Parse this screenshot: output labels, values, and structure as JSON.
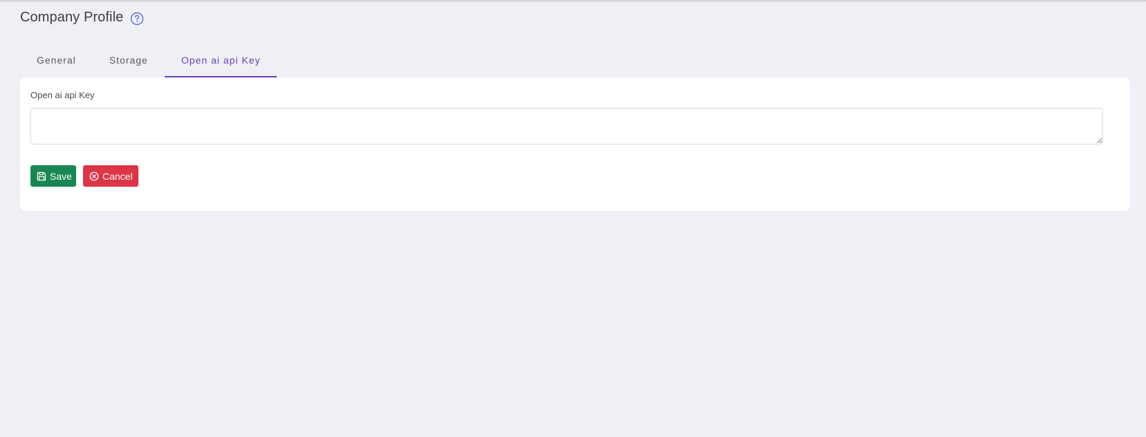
{
  "page": {
    "title": "Company Profile",
    "help_icon": "question-circle-icon"
  },
  "tabs": [
    {
      "label": "General",
      "active": false
    },
    {
      "label": "Storage",
      "active": false
    },
    {
      "label": "Open ai api Key",
      "active": true
    }
  ],
  "form": {
    "field_label": "Open ai api Key",
    "field_value": "",
    "save_label": "Save",
    "save_icon": "floppy-disk-icon",
    "cancel_label": "Cancel",
    "cancel_icon": "x-circle-icon"
  },
  "colors": {
    "accent": "#6a3fb0",
    "help_icon": "#5b6fd8",
    "save": "#198754",
    "cancel": "#dc3545",
    "background": "#eff0f5"
  }
}
